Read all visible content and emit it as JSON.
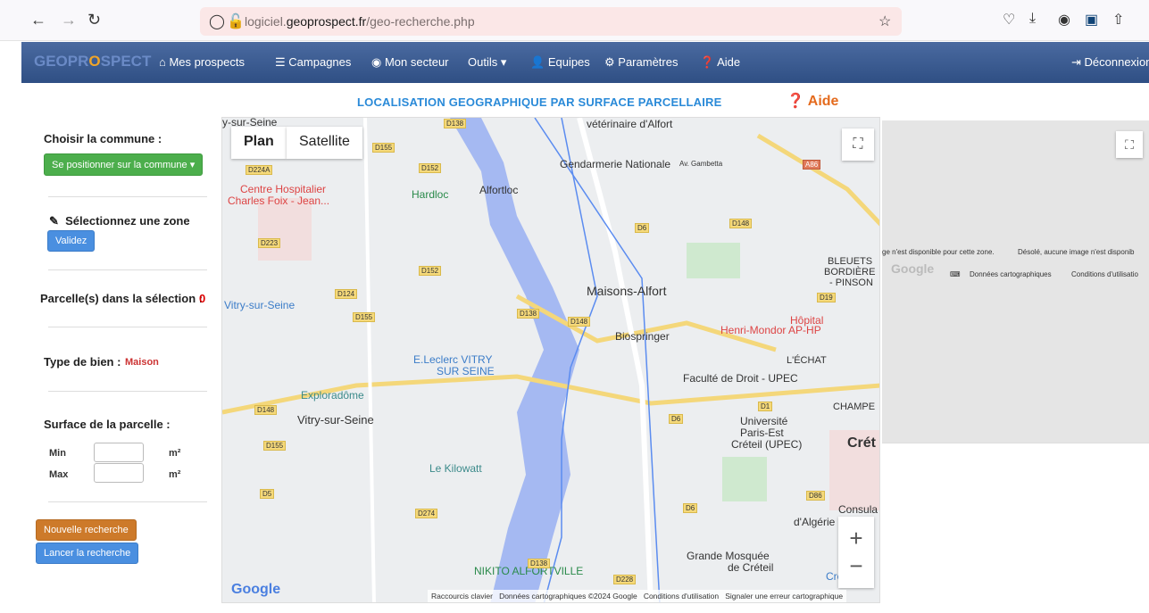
{
  "browser": {
    "back_icon": "arrow-left-icon",
    "forward_icon": "arrow-right-icon",
    "reload_icon": "reload-icon",
    "url_prefix": "logiciel.",
    "url_domain": "geoprospect.fr",
    "url_path": "/geo-recherche.php"
  },
  "navbar": {
    "logo_a": "GEO",
    "logo_b": "PR",
    "logo_o": "O",
    "logo_c": "SPECT",
    "items": [
      "Mes prospects",
      "Campagnes",
      "Mon secteur",
      "Outils",
      "Equipes",
      "Paramètres",
      "Aide"
    ],
    "logout": "Déconnexion"
  },
  "header": {
    "title": "LOCALISATION GEOGRAPHIQUE PAR SURFACE PARCELLAIRE",
    "help": "Aide"
  },
  "sidebar": {
    "commune_label": "Choisir la commune :",
    "commune_button": "Se positionner sur la commune",
    "zone_label": "Sélectionnez une zone",
    "validate_button": "Validez",
    "parcels_label": "Parcelle(s) dans la sélection :",
    "parcels_count": "0",
    "type_label": "Type de bien :",
    "type_value": "Maison",
    "surface_label": "Surface de la parcelle :",
    "min_label": "Min",
    "max_label": "Max",
    "unit": "m²",
    "new_search": "Nouvelle recherche",
    "launch_search": "Lancer la recherche"
  },
  "map": {
    "tab_plan": "Plan",
    "tab_satellite": "Satellite",
    "labels": [
      "Centre Hospitalier",
      "Charles Foix - Jean...",
      "Hardloc",
      "Alfortloc",
      "Gendarmerie Nationale",
      "Av. Gambetta",
      "vétérinaire d'Alfort",
      "Vitry-sur-Seine",
      "Maisons-Alfort",
      "Biospringer",
      "Hôpital",
      "Henri-Mondor AP-HP",
      "E.Leclerc VITRY",
      "SUR SEINE",
      "Exploradôme",
      "Vitry-sur-Seine",
      "Faculté de Droit - UPEC",
      "Université",
      "Paris-Est",
      "Créteil (UPEC)",
      "Le Kilowatt",
      "NIKITO ALFORTVILLE",
      "Grande Mosquée",
      "de Créteil",
      "BLEUETS",
      "BORDIÈRE",
      "- PINSON",
      "L'ÉCHAT",
      "CHAMPE",
      "Créteil S",
      "Consula",
      "d'Algérie",
      "y-sur-Seine",
      "Crét"
    ],
    "roads": [
      "D138",
      "D155",
      "D224A",
      "D152",
      "D223",
      "D124",
      "D155",
      "D148",
      "D6",
      "D148",
      "D152",
      "D138",
      "D19",
      "D1",
      "D6",
      "D155",
      "D5",
      "D274",
      "D138",
      "D228",
      "D86",
      "D6",
      "A86",
      "D148"
    ],
    "footer": [
      "Raccourcis clavier",
      "Données cartographiques ©2024 Google",
      "Conditions d'utilisation",
      "Signaler une erreur cartographique"
    ],
    "google": "Google"
  },
  "map2": {
    "msg1": "ge n'est disponible pour cette zone.",
    "msg2": "Désolé, aucune image n'est disponib",
    "footer": [
      "Données cartographiques",
      "Conditions d'utilisatio"
    ],
    "google": "Google"
  }
}
